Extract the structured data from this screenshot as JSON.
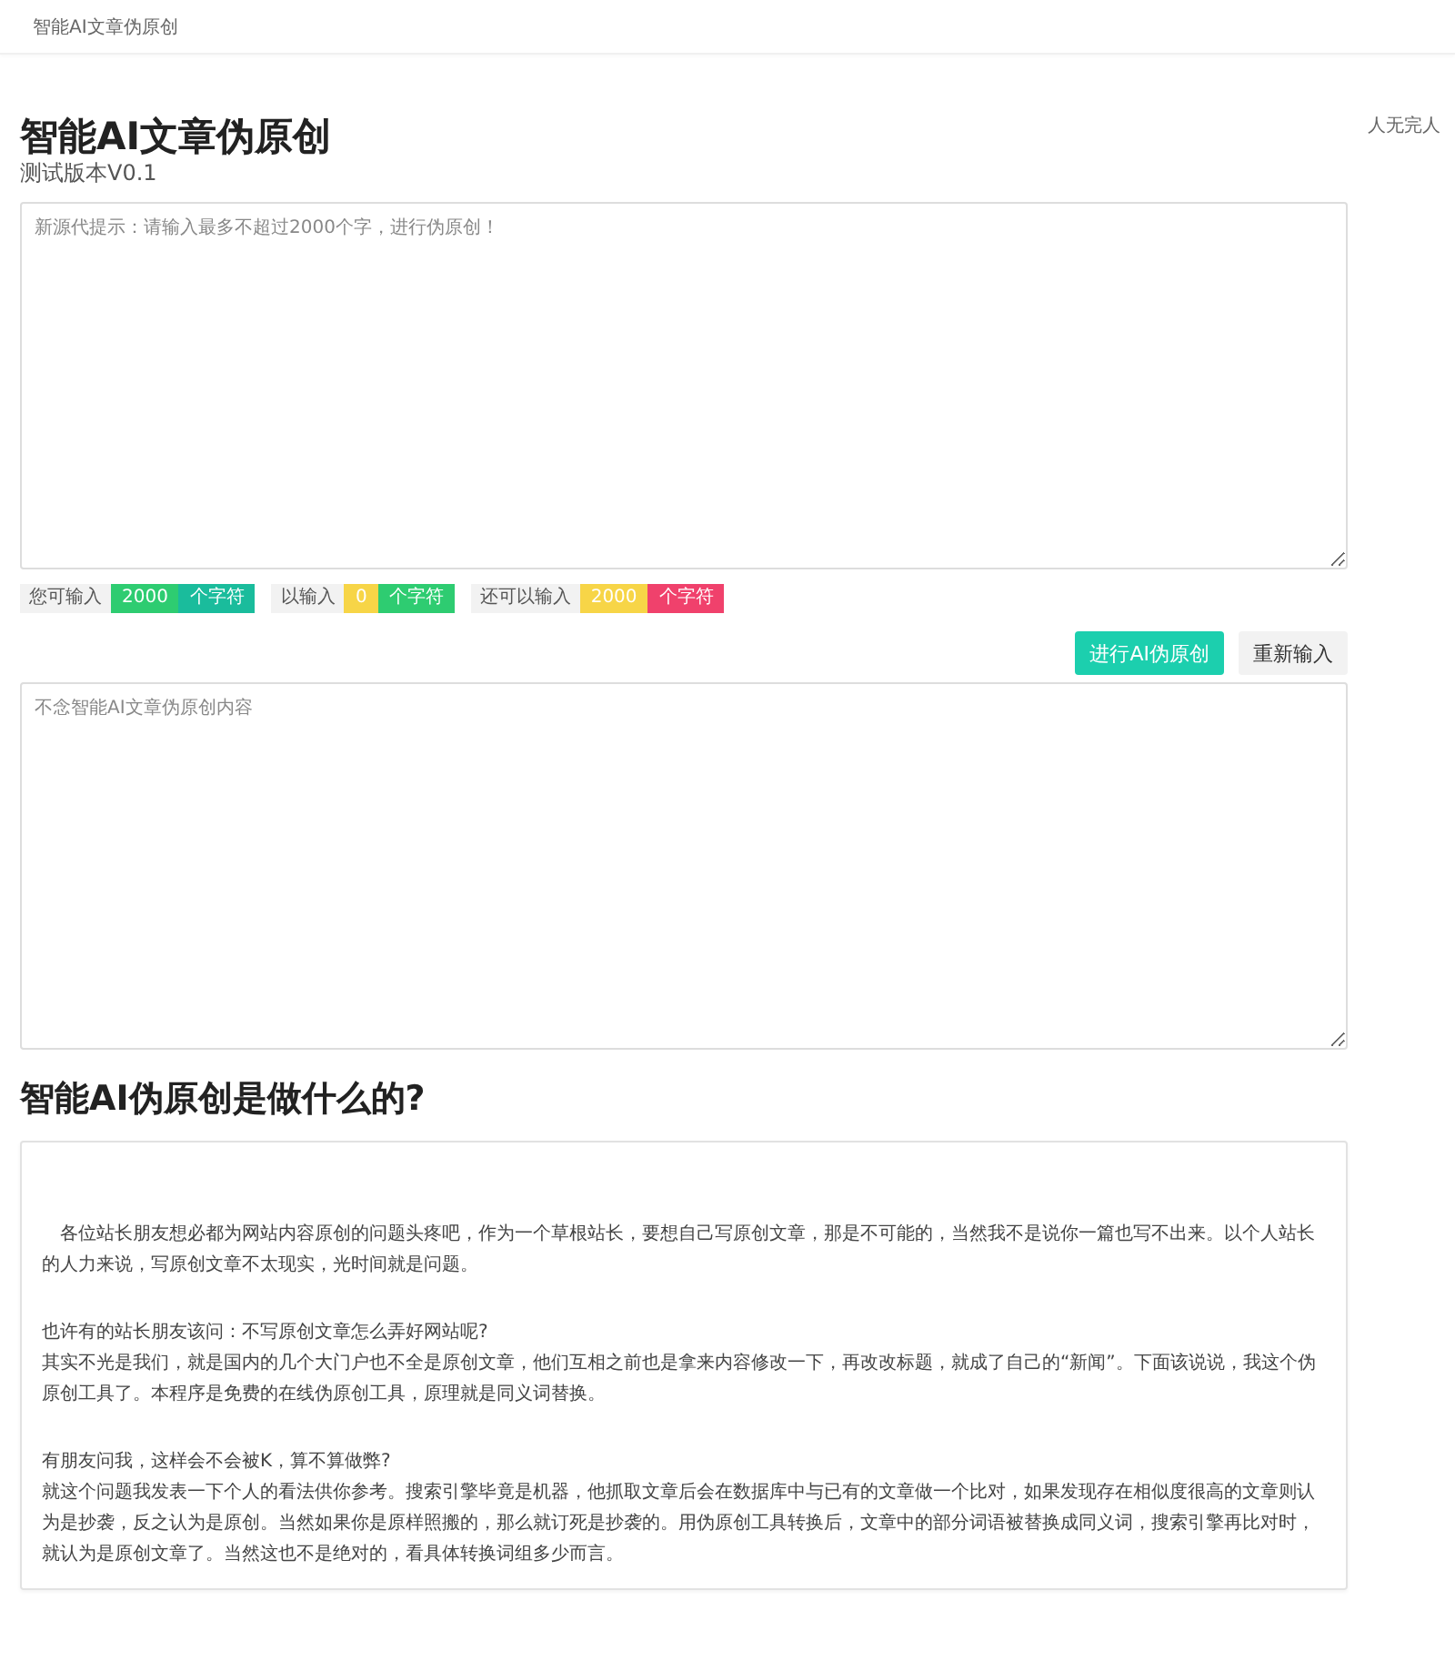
{
  "navbar": {
    "brand": "智能AI文章伪原创"
  },
  "header": {
    "title": "智能AI文章伪原创",
    "subtitle": "测试版本V0.1",
    "side_note": "人无完人"
  },
  "input_box": {
    "placeholder": "新源代提示：请输入最多不超过2000个字，进行伪原创！"
  },
  "counters": [
    {
      "label": "您可输入",
      "badges": [
        {
          "text": "2000",
          "color": "#2ecc71"
        },
        {
          "text": "个字符",
          "color": "#1abc9c"
        }
      ]
    },
    {
      "label": "以输入",
      "badges": [
        {
          "text": "0",
          "color": "#f7d547"
        },
        {
          "text": "个字符",
          "color": "#2ecc71"
        }
      ]
    },
    {
      "label": "还可以输入",
      "badges": [
        {
          "text": "2000",
          "color": "#f7d547"
        },
        {
          "text": "个字符",
          "color": "#f0416c"
        }
      ]
    }
  ],
  "buttons": [
    {
      "label": "进行AI伪原创",
      "kind": "primary"
    },
    {
      "label": "重新输入",
      "kind": "default"
    }
  ],
  "output_box": {
    "placeholder": "不念智能AI文章伪原创内容"
  },
  "section": {
    "heading": "智能AI伪原创是做什么的?",
    "paragraphs": [
      [
        "　各位站长朋友想必都为网站内容原创的问题头疼吧，作为一个草根站长，要想自己写原创文章，那是不可能的，当然我不是说你一篇也写不出来。以个人站长的人力来说，写原创文章不太现实，光时间就是问题。"
      ],
      [
        "也许有的站长朋友该问：不写原创文章怎么弄好网站呢?",
        "其实不光是我们，就是国内的几个大门户也不全是原创文章，他们互相之前也是拿来内容修改一下，再改改标题，就成了自己的“新闻”。下面该说说，我这个伪原创工具了。本程序是免费的在线伪原创工具，原理就是同义词替换。"
      ],
      [
        "有朋友问我，这样会不会被K，算不算做弊?",
        "就这个问题我发表一下个人的看法供你参考。搜索引擎毕竟是机器，他抓取文章后会在数据库中与已有的文章做一个比对，如果发现存在相似度很高的文章则认为是抄袭，反之认为是原创。当然如果你是原样照搬的，那么就订死是抄袭的。用伪原创工具转换后，文章中的部分词语被替换成同义词，搜索引擎再比对时，就认为是原创文章了。当然这也不是绝对的，看具体转换词组多少而言。"
      ]
    ]
  }
}
